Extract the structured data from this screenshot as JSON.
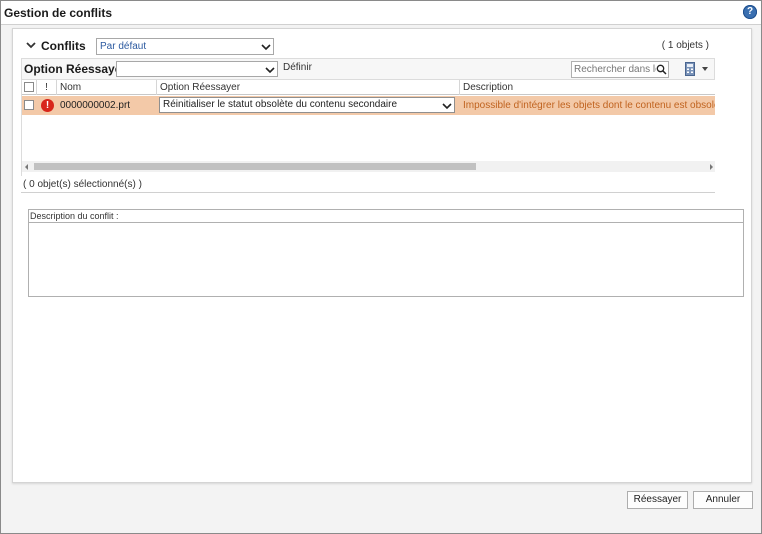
{
  "window": {
    "title": "Gestion de conflits"
  },
  "conflicts": {
    "section_label": "Conflits",
    "view_selected": "Par défaut",
    "object_count": "( 1 objets )"
  },
  "toolbar": {
    "retry_label": "Option Réessayer",
    "retry_value": "",
    "define_label": "Définir",
    "search_placeholder": "Rechercher dans le tableau"
  },
  "table": {
    "columns": [
      "!",
      "Nom",
      "Option Réessayer",
      "Description"
    ],
    "rows": [
      {
        "name": "0000000002.prt",
        "retry_option": "Réinitialiser le statut obsolète du contenu secondaire",
        "description": "Impossible d'intégrer les objets dont le contenu est obsolète"
      }
    ]
  },
  "status": {
    "selected_count": "( 0 objet(s) sélectionné(s) )"
  },
  "detail": {
    "label": "Description du conflit :",
    "text": ""
  },
  "actions": {
    "retry_label": "Réessayer",
    "cancel_label": "Annuler"
  },
  "colors": {
    "row_error_bg": "#f3c9a8",
    "error_icon": "#d8261b",
    "description_text": "#c0631f",
    "link_blue": "#2c5aa0"
  },
  "icons": [
    "help-icon",
    "chevron-down-icon",
    "search-icon",
    "calculator-icon",
    "error-icon"
  ]
}
